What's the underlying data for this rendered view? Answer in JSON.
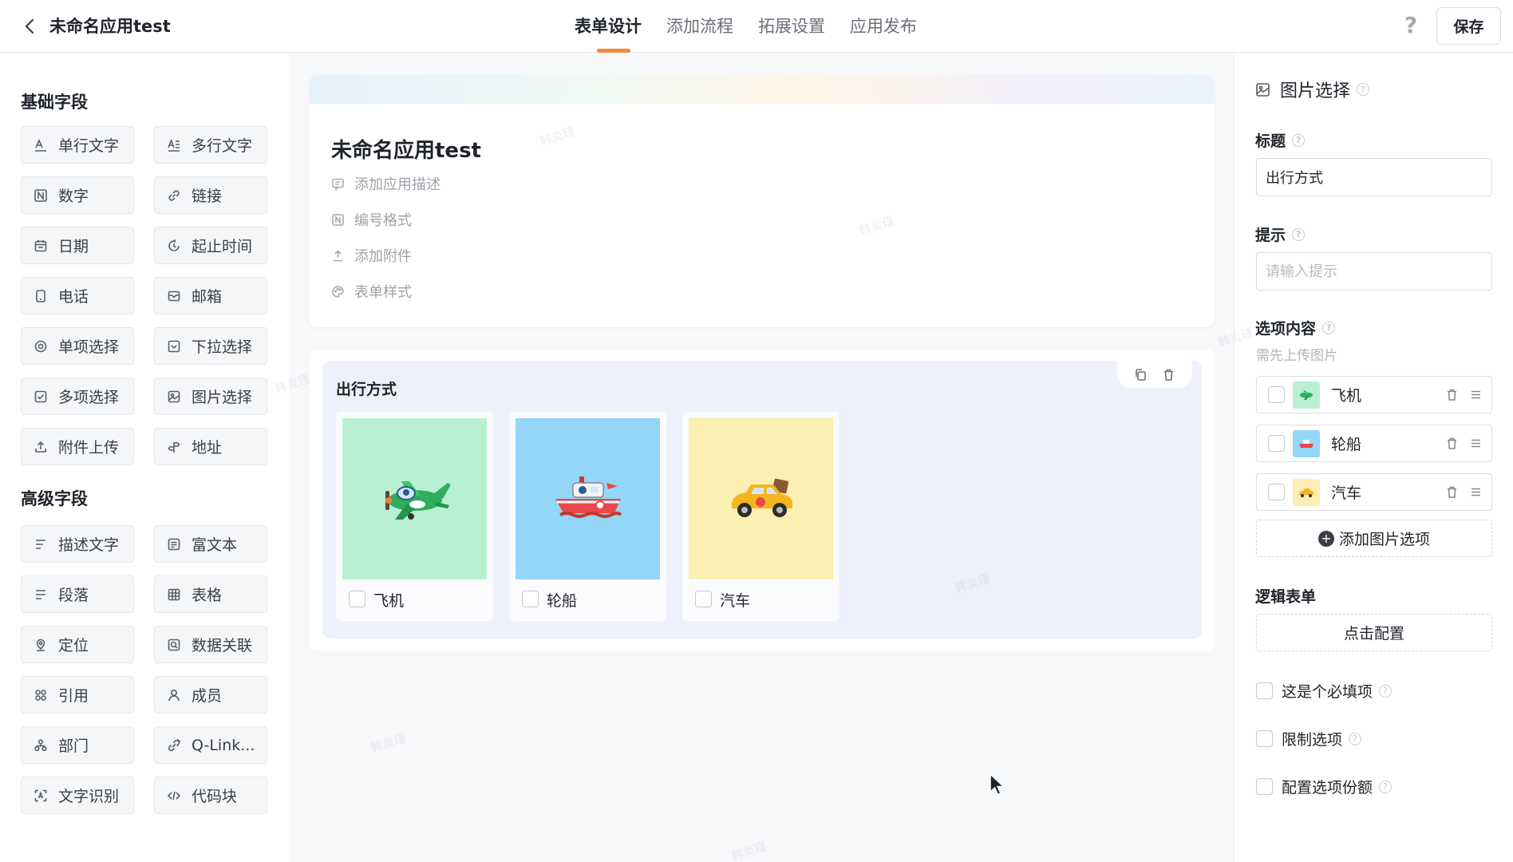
{
  "header": {
    "app_title": "未命名应用test",
    "tabs": [
      {
        "label": "表单设计",
        "active": true
      },
      {
        "label": "添加流程",
        "active": false
      },
      {
        "label": "拓展设置",
        "active": false
      },
      {
        "label": "应用发布",
        "active": false
      }
    ],
    "help_label": "?",
    "save_label": "保存"
  },
  "palette": {
    "basic_title": "基础字段",
    "basic_fields": [
      {
        "label": "单行文字",
        "icon": "text-line-icon"
      },
      {
        "label": "多行文字",
        "icon": "text-multiline-icon"
      },
      {
        "label": "数字",
        "icon": "number-icon"
      },
      {
        "label": "链接",
        "icon": "link-icon"
      },
      {
        "label": "日期",
        "icon": "calendar-icon"
      },
      {
        "label": "起止时间",
        "icon": "time-range-icon"
      },
      {
        "label": "电话",
        "icon": "phone-icon"
      },
      {
        "label": "邮箱",
        "icon": "mail-icon"
      },
      {
        "label": "单项选择",
        "icon": "radio-icon"
      },
      {
        "label": "下拉选择",
        "icon": "dropdown-icon"
      },
      {
        "label": "多项选择",
        "icon": "checkbox-icon"
      },
      {
        "label": "图片选择",
        "icon": "image-icon"
      },
      {
        "label": "附件上传",
        "icon": "upload-icon"
      },
      {
        "label": "地址",
        "icon": "address-icon"
      }
    ],
    "advanced_title": "高级字段",
    "advanced_fields": [
      {
        "label": "描述文字",
        "icon": "description-icon"
      },
      {
        "label": "富文本",
        "icon": "rich-text-icon"
      },
      {
        "label": "段落",
        "icon": "paragraph-icon"
      },
      {
        "label": "表格",
        "icon": "table-icon"
      },
      {
        "label": "定位",
        "icon": "location-icon"
      },
      {
        "label": "数据关联",
        "icon": "data-link-icon"
      },
      {
        "label": "引用",
        "icon": "reference-icon"
      },
      {
        "label": "成员",
        "icon": "member-icon"
      },
      {
        "label": "部门",
        "icon": "department-icon"
      },
      {
        "label": "Q-Link...",
        "icon": "qlink-icon"
      },
      {
        "label": "文字识别",
        "icon": "ocr-icon"
      },
      {
        "label": "代码块",
        "icon": "code-icon"
      }
    ]
  },
  "form": {
    "name": "未命名应用test",
    "actions": [
      {
        "label": "添加应用描述",
        "icon": "comment-icon"
      },
      {
        "label": "编号格式",
        "icon": "number-format-icon"
      },
      {
        "label": "添加附件",
        "icon": "upload-icon"
      },
      {
        "label": "表单样式",
        "icon": "palette-icon"
      }
    ],
    "field": {
      "label": "出行方式",
      "options": [
        {
          "label": "飞机",
          "bg": "#b9f0d2",
          "picture": "airplane"
        },
        {
          "label": "轮船",
          "bg": "#93d6f7",
          "picture": "ship"
        },
        {
          "label": "汽车",
          "bg": "#fbefb3",
          "picture": "car"
        }
      ]
    }
  },
  "props": {
    "heading": "图片选择",
    "title_label": "标题",
    "title_value": "出行方式",
    "hint_label": "提示",
    "hint_placeholder": "请输入提示",
    "options_label": "选项内容",
    "options_sub": "需先上传图片",
    "options": [
      {
        "label": "飞机",
        "bg": "#b9f0d2"
      },
      {
        "label": "轮船",
        "bg": "#93d6f7"
      },
      {
        "label": "汽车",
        "bg": "#fbefb3"
      }
    ],
    "add_option_label": "添加图片选项",
    "logic_label": "逻辑表单",
    "logic_button": "点击配置",
    "checks": [
      {
        "label": "这是个必填项"
      },
      {
        "label": "限制选项"
      },
      {
        "label": "配置选项份额"
      }
    ]
  },
  "watermark_text": "韩炎瑾",
  "colors": {
    "accent": "#f08a3e",
    "canvas_bg": "#f7f8fa",
    "field_card_bg": "#eef0fb"
  }
}
